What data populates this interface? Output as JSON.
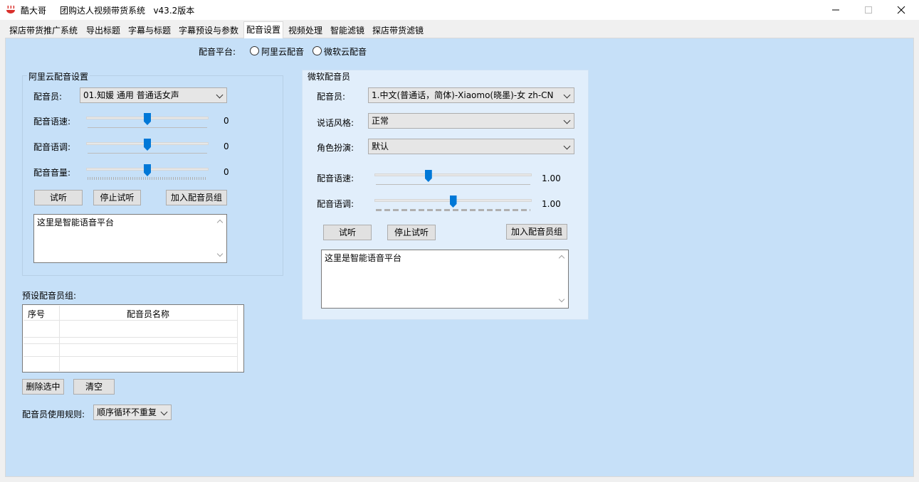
{
  "window": {
    "app_name": "酷大哥",
    "title": "团购达人视频带货系统   v43.2版本",
    "minimize_icon": "minimize-icon",
    "maximize_icon": "maximize-icon",
    "close_icon": "close-icon"
  },
  "tabs": [
    {
      "label": "探店带货推广系统"
    },
    {
      "label": "导出标题"
    },
    {
      "label": "字幕与标题"
    },
    {
      "label": "字幕预设与参数"
    },
    {
      "label": "配音设置",
      "active": true
    },
    {
      "label": "视频处理"
    },
    {
      "label": "智能滤镜"
    },
    {
      "label": "探店带货滤镜"
    }
  ],
  "platform": {
    "label": "配音平台:",
    "options": [
      "阿里云配音",
      "微软云配音"
    ],
    "selected": null
  },
  "aliyun": {
    "title": "阿里云配音设置",
    "voice_label": "配音员:",
    "voice_value": "01.知媛 通用 普通话女声",
    "speed_label": "配音语速:",
    "speed_value": "0",
    "speed_level": 0.5,
    "pitch_label": "配音语调:",
    "pitch_value": "0",
    "pitch_level": 0.5,
    "volume_label": "配音音量:",
    "volume_value": "0",
    "volume_level": 0.5,
    "listen_button": "试听",
    "stop_button": "停止试听",
    "add_button": "加入配音员组",
    "text": "这里是智能语音平台"
  },
  "microsoft": {
    "title": "微软配音员",
    "voice_label": "配音员:",
    "voice_value": "1.中文(普通话，简体)-Xiaomo(晓墨)-女 zh-CN",
    "style_label": "说话风格:",
    "style_value": "正常",
    "role_label": "角色扮演:",
    "role_value": "默认",
    "speed_label": "配音语速:",
    "speed_value": "1.00",
    "speed_level": 0.34,
    "pitch_label": "配音语调:",
    "pitch_value": "1.00",
    "pitch_level": 0.5,
    "listen_button": "试听",
    "stop_button": "停止试听",
    "add_button": "加入配音员组",
    "text": "这里是智能语音平台"
  },
  "preset_group": {
    "title": "预设配音员组:",
    "columns": [
      "序号",
      "配音员名称"
    ],
    "rows": [],
    "delete_button": "删除选中",
    "clear_button": "清空",
    "rule_label": "配音员使用规则:",
    "rule_value": "顺序循环不重复"
  },
  "colors": {
    "panel_bg": "#c6e0f8",
    "accent": "#0078d7",
    "app_icon": "#d9302b"
  }
}
